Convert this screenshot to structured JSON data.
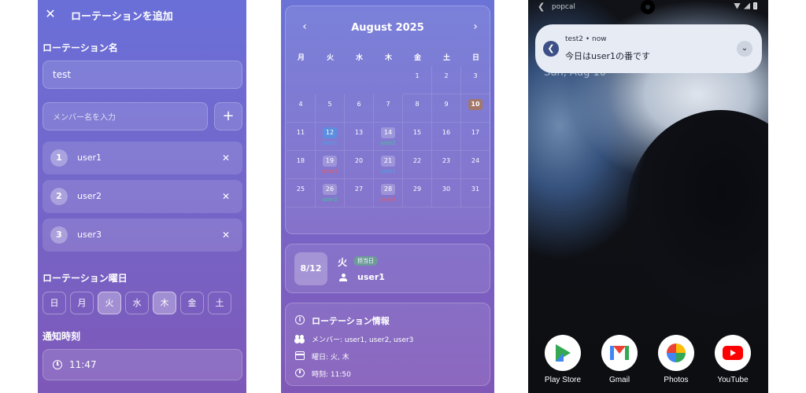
{
  "panel1": {
    "title": "ローテーションを追加",
    "name_label": "ローテーション名",
    "name_value": "test",
    "member_placeholder": "メンバー名を入力",
    "add_symbol": "+",
    "members": [
      {
        "num": "1",
        "name": "user1"
      },
      {
        "num": "2",
        "name": "user2"
      },
      {
        "num": "3",
        "name": "user3"
      }
    ],
    "weekday_label": "ローテーション曜日",
    "weekdays": [
      {
        "label": "日",
        "selected": false
      },
      {
        "label": "月",
        "selected": false
      },
      {
        "label": "火",
        "selected": true
      },
      {
        "label": "水",
        "selected": false
      },
      {
        "label": "木",
        "selected": true
      },
      {
        "label": "金",
        "selected": false
      },
      {
        "label": "土",
        "selected": false
      }
    ],
    "time_label": "通知時刻",
    "time_value": "11:47"
  },
  "panel2": {
    "month": "August 2025",
    "weekday_headers": [
      "月",
      "火",
      "水",
      "木",
      "金",
      "土",
      "日"
    ],
    "weeks": [
      [
        null,
        null,
        null,
        null,
        {
          "d": "1"
        },
        {
          "d": "2"
        },
        {
          "d": "3"
        }
      ],
      [
        {
          "d": "4"
        },
        {
          "d": "5"
        },
        {
          "d": "6"
        },
        {
          "d": "7"
        },
        {
          "d": "8"
        },
        {
          "d": "9"
        },
        {
          "d": "10",
          "hl": "ten"
        }
      ],
      [
        {
          "d": "11"
        },
        {
          "d": "12",
          "hl": "today",
          "u": "user1",
          "c": "u1"
        },
        {
          "d": "13"
        },
        {
          "d": "14",
          "hl": "chip",
          "u": "user2",
          "c": "u2"
        },
        {
          "d": "15"
        },
        {
          "d": "16"
        },
        {
          "d": "17"
        }
      ],
      [
        {
          "d": "18"
        },
        {
          "d": "19",
          "hl": "chip",
          "u": "user3",
          "c": "u3"
        },
        {
          "d": "20"
        },
        {
          "d": "21",
          "hl": "chip",
          "u": "user1",
          "c": "u1"
        },
        {
          "d": "22"
        },
        {
          "d": "23"
        },
        {
          "d": "24"
        }
      ],
      [
        {
          "d": "25"
        },
        {
          "d": "26",
          "hl": "chip",
          "u": "user2",
          "c": "u2"
        },
        {
          "d": "27"
        },
        {
          "d": "28",
          "hl": "chip",
          "u": "user3",
          "c": "u3"
        },
        {
          "d": "29"
        },
        {
          "d": "30"
        },
        {
          "d": "31"
        }
      ]
    ],
    "selected_date": "8/12",
    "selected_weekday": "火",
    "badge": "担当日",
    "selected_user": "user1",
    "info_title": "ローテーション情報",
    "info_members": "メンバー: user1, user2, user3",
    "info_days": "曜日: 火, 木",
    "info_time": "時刻: 11:50"
  },
  "panel3": {
    "status_app": "popcal",
    "notif_title": "test2 • now",
    "notif_body": "今日はuser1の番です",
    "date_under": "Sun, Aug 10",
    "apps": [
      {
        "label": "Play Store",
        "icon": "play-store-icon"
      },
      {
        "label": "Gmail",
        "icon": "gmail-icon"
      },
      {
        "label": "Photos",
        "icon": "photos-icon"
      },
      {
        "label": "YouTube",
        "icon": "youtube-icon"
      }
    ]
  }
}
